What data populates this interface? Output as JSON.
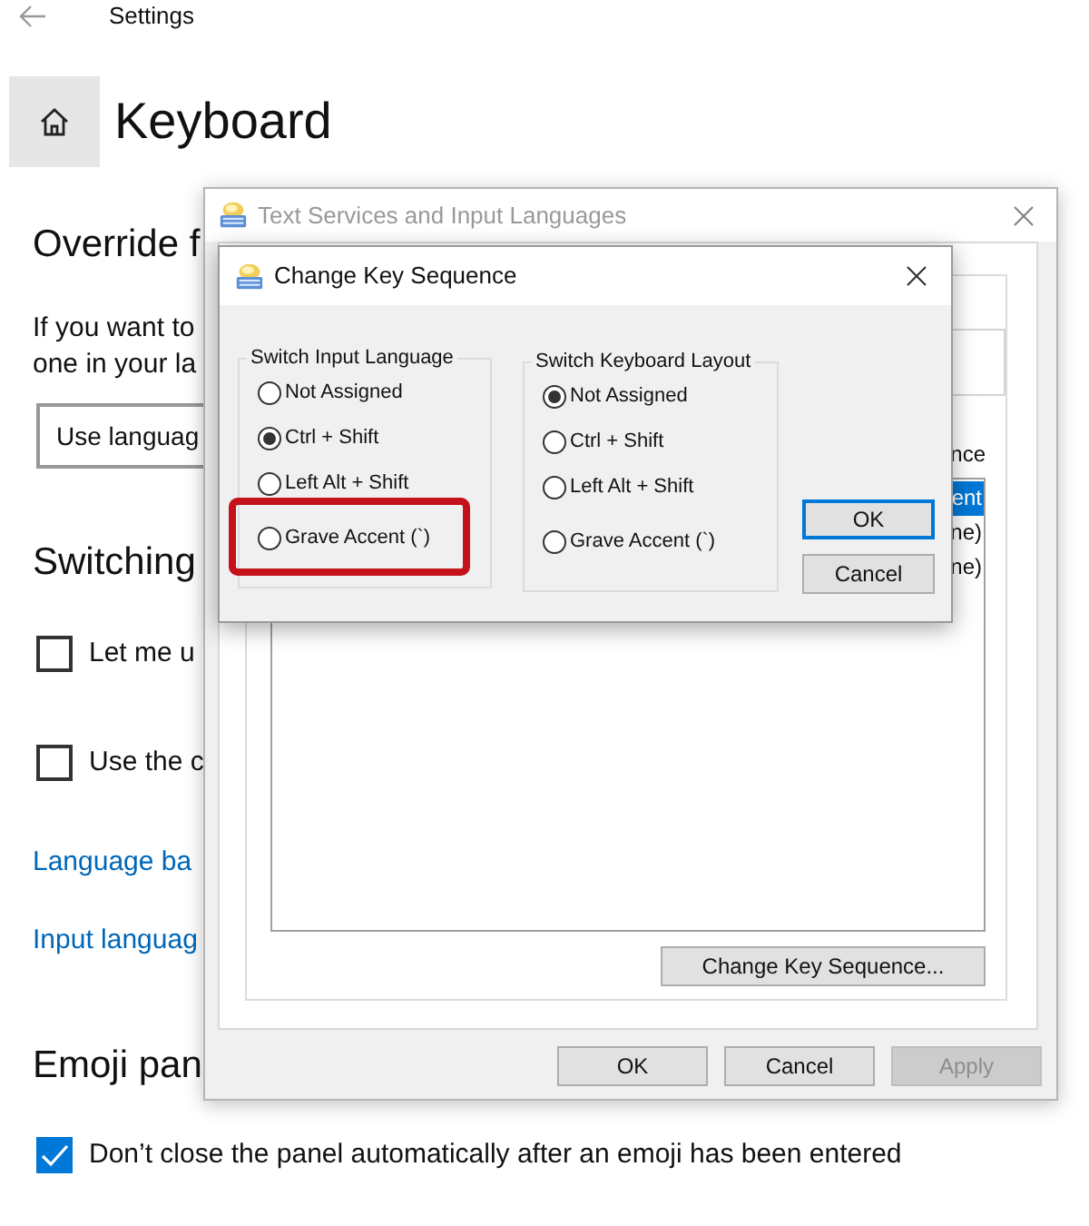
{
  "settings": {
    "title": "Settings",
    "page_title": "Keyboard",
    "items": [
      {
        "kind": "heading",
        "text": "Override f"
      },
      {
        "kind": "paragraph",
        "lines": [
          "If you want to",
          "one in your la"
        ]
      },
      {
        "kind": "dropdown",
        "value": "Use languag"
      },
      {
        "kind": "heading",
        "text": "Switching"
      },
      {
        "kind": "checkbox",
        "label": "Let me u",
        "checked": false
      },
      {
        "kind": "checkbox",
        "label": "Use the c",
        "checked": false
      },
      {
        "kind": "link",
        "text": "Language ba"
      },
      {
        "kind": "link",
        "text": "Input languag"
      },
      {
        "kind": "heading",
        "text": "Emoji pan"
      },
      {
        "kind": "checkbox",
        "label": "Don’t close the panel automatically after an emoji has been entered",
        "checked": true
      }
    ]
  },
  "text_services_window": {
    "title": "Text Services and Input Languages",
    "column_header": "nce",
    "list_items": [
      {
        "text": "ent",
        "selected": true
      },
      {
        "text": "ne)",
        "selected": false
      },
      {
        "text": "ne)",
        "selected": false
      }
    ],
    "change_key_sequence_button": "Change Key Sequence...",
    "buttons": [
      {
        "label": "OK",
        "disabled": false
      },
      {
        "label": "Cancel",
        "disabled": false
      },
      {
        "label": "Apply",
        "disabled": true
      }
    ]
  },
  "change_key_sequence_dialog": {
    "title": "Change Key Sequence",
    "groups": [
      {
        "title": "Switch Input Language",
        "options": [
          {
            "label": "Not Assigned",
            "selected": false,
            "highlighted": false
          },
          {
            "label": "Ctrl + Shift",
            "selected": true,
            "highlighted": false
          },
          {
            "label": "Left Alt + Shift",
            "selected": false,
            "highlighted": false
          },
          {
            "label": "Grave Accent (`)",
            "selected": false,
            "highlighted": true
          }
        ]
      },
      {
        "title": "Switch Keyboard Layout",
        "options": [
          {
            "label": "Not Assigned",
            "selected": true,
            "highlighted": false
          },
          {
            "label": "Ctrl + Shift",
            "selected": false,
            "highlighted": false
          },
          {
            "label": "Left Alt + Shift",
            "selected": false,
            "highlighted": false
          },
          {
            "label": "Grave Accent (`)",
            "selected": false,
            "highlighted": false
          }
        ]
      }
    ],
    "buttons": [
      {
        "label": "OK",
        "default": true
      },
      {
        "label": "Cancel",
        "default": false
      }
    ]
  }
}
